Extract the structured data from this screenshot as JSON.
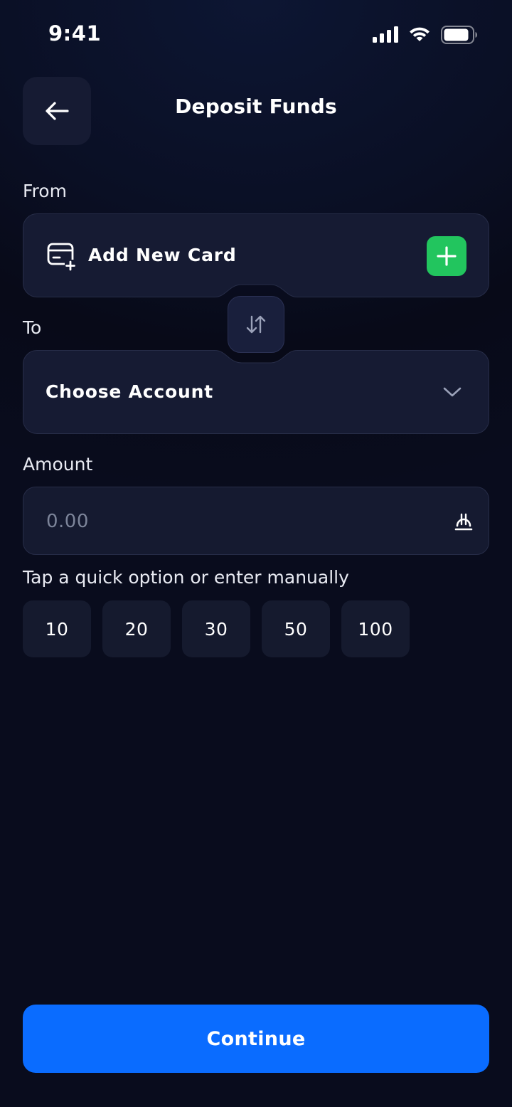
{
  "status_bar": {
    "time": "9:41",
    "icons": [
      "cellular-signal-icon",
      "wifi-icon",
      "battery-icon"
    ]
  },
  "header": {
    "back_icon": "arrow-left-icon",
    "title": "Deposit Funds"
  },
  "from_section": {
    "label": "From",
    "card_icon": "card-add-icon",
    "card_text": "Add New Card",
    "add_icon": "plus-icon"
  },
  "swap": {
    "icon": "swap-vertical-icon"
  },
  "to_section": {
    "label": "To",
    "account_text": "Choose Account",
    "dropdown_icon": "chevron-down-icon"
  },
  "amount_section": {
    "label": "Amount",
    "placeholder": "0.00",
    "currency_icon": "lari-currency-icon"
  },
  "quick_options": {
    "hint": "Tap a quick option or enter manually",
    "values": [
      "10",
      "20",
      "30",
      "50",
      "100"
    ]
  },
  "footer": {
    "continue_label": "Continue"
  },
  "colors": {
    "background": "#0a0f24",
    "card_background": "#161b33",
    "accent_green": "#22c55e",
    "primary_blue": "#0a6cff",
    "placeholder": "#7c8499"
  }
}
